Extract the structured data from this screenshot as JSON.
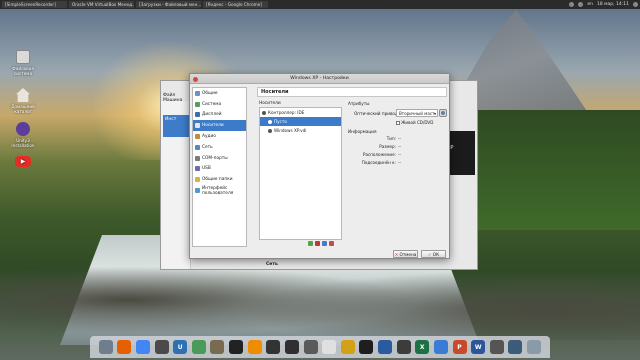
{
  "taskbar": {
    "tasks": [
      "[SimpleScreenRecorder]",
      "Oracle VM VirtualBox Менед...",
      "[Загрузки - Файловый мен...",
      "[Яндекс - Google Chrome]"
    ],
    "clock": "18 мар, 14:11",
    "lang": "en"
  },
  "desktop_icons": [
    {
      "label": "Файловая система",
      "icon": "drive-icon",
      "color": "#dadada"
    },
    {
      "label": "Домашний каталог",
      "icon": "home-folder-icon",
      "color": "#e9e4dc"
    },
    {
      "label": "Unity3 Installation",
      "icon": "unity-icon",
      "color": "#5b3e9c"
    },
    {
      "label": "",
      "icon": "youtube-icon",
      "color": "#e52d27"
    }
  ],
  "background_window": {
    "menu": "Файл  Машина",
    "vm_name": "Инст",
    "preview_text": "XP",
    "bottom_label": "Сеть"
  },
  "dialog": {
    "title": "Windows XP - Настройки",
    "categories": [
      {
        "label": "Общие",
        "icon": "general-icon",
        "color": "#6a8fc9"
      },
      {
        "label": "Система",
        "icon": "system-icon",
        "color": "#5a9a5a"
      },
      {
        "label": "Дисплей",
        "icon": "display-icon",
        "color": "#3b6fa8"
      },
      {
        "label": "Носители",
        "icon": "storage-icon",
        "color": "#e6e6e6",
        "selected": true
      },
      {
        "label": "Аудио",
        "icon": "audio-icon",
        "color": "#c78a3a"
      },
      {
        "label": "Сеть",
        "icon": "network-icon",
        "color": "#4a8ac7"
      },
      {
        "label": "COM-порты",
        "icon": "serial-port-icon",
        "color": "#7a7a7a"
      },
      {
        "label": "USB",
        "icon": "usb-icon",
        "color": "#6b6bb3"
      },
      {
        "label": "Общие папки",
        "icon": "shared-folder-icon",
        "color": "#d6b23e"
      },
      {
        "label": "Интерфейс пользователя",
        "icon": "ui-icon",
        "color": "#4f9cc9"
      }
    ],
    "page_title": "Носители",
    "storage_label": "Носители",
    "tree": [
      {
        "label": "Контроллер: IDE",
        "icon": "controller-icon",
        "level": 0
      },
      {
        "label": "Пусто",
        "icon": "optical-disc-icon",
        "level": 1,
        "selected": true
      },
      {
        "label": "Windows XP.vdi",
        "icon": "hard-disk-icon",
        "level": 1
      }
    ],
    "tree_tools": [
      {
        "icon": "add-attachment-icon",
        "color": "#5aa04a"
      },
      {
        "icon": "remove-attachment-icon",
        "color": "#c0392b"
      },
      {
        "icon": "add-controller-icon",
        "color": "#4a7ac7"
      },
      {
        "icon": "remove-controller-icon",
        "color": "#c74a4a"
      }
    ],
    "attributes": {
      "heading": "Атрибуты",
      "drive_label": "Оптический привод:",
      "drive_value": "Вторичный маст.",
      "live_cd": "Живой CD/DVD"
    },
    "information": {
      "heading": "Информация",
      "rows": [
        {
          "label": "Тип:",
          "value": "--"
        },
        {
          "label": "Размер:",
          "value": "--"
        },
        {
          "label": "Расположение:",
          "value": "--"
        },
        {
          "label": "Подсоединён к:",
          "value": "--"
        }
      ]
    },
    "buttons": {
      "cancel": "Отмена",
      "ok": "ОК"
    }
  },
  "dock_apps": [
    {
      "icon": "files-icon",
      "color": "#6f7d8c",
      "glyph": ""
    },
    {
      "icon": "firefox-icon",
      "color": "#e66000",
      "glyph": ""
    },
    {
      "icon": "chrome-icon",
      "color": "#4285f4",
      "glyph": ""
    },
    {
      "icon": "settings-icon",
      "color": "#4a4a4a",
      "glyph": ""
    },
    {
      "icon": "hub-icon",
      "color": "#2f6fb3",
      "glyph": "U"
    },
    {
      "icon": "vpn-icon",
      "color": "#4a9a5a",
      "glyph": ""
    },
    {
      "icon": "gimp-icon",
      "color": "#7a6a50",
      "glyph": ""
    },
    {
      "icon": "inkscape-icon",
      "color": "#222222",
      "glyph": ""
    },
    {
      "icon": "vlc-icon",
      "color": "#f08c00",
      "glyph": ""
    },
    {
      "icon": "clapper-icon",
      "color": "#333333",
      "glyph": ""
    },
    {
      "icon": "obs-icon",
      "color": "#302e31",
      "glyph": ""
    },
    {
      "icon": "writer-icon",
      "color": "#5a5a5a",
      "glyph": ""
    },
    {
      "icon": "notes-icon",
      "color": "#e0e0e0",
      "glyph": ""
    },
    {
      "icon": "burn-icon",
      "color": "#d4a017",
      "glyph": ""
    },
    {
      "icon": "terminal-icon",
      "color": "#1e1e1e",
      "glyph": ""
    },
    {
      "icon": "virtualbox-icon",
      "color": "#2a5aa0",
      "glyph": ""
    },
    {
      "icon": "gedit-icon",
      "color": "#3c3c3c",
      "glyph": ""
    },
    {
      "icon": "excel-icon",
      "color": "#1e7145",
      "glyph": "X"
    },
    {
      "icon": "text-editor-icon",
      "color": "#3a7bd5",
      "glyph": ""
    },
    {
      "icon": "ppt-icon",
      "color": "#c94a2b",
      "glyph": "P"
    },
    {
      "icon": "word-icon",
      "color": "#2b579a",
      "glyph": "W"
    },
    {
      "icon": "screenshot-icon",
      "color": "#555555",
      "glyph": ""
    },
    {
      "icon": "photos-icon",
      "color": "#3c5a7a",
      "glyph": ""
    },
    {
      "icon": "trash-icon",
      "color": "#8a9aa8",
      "glyph": ""
    }
  ]
}
